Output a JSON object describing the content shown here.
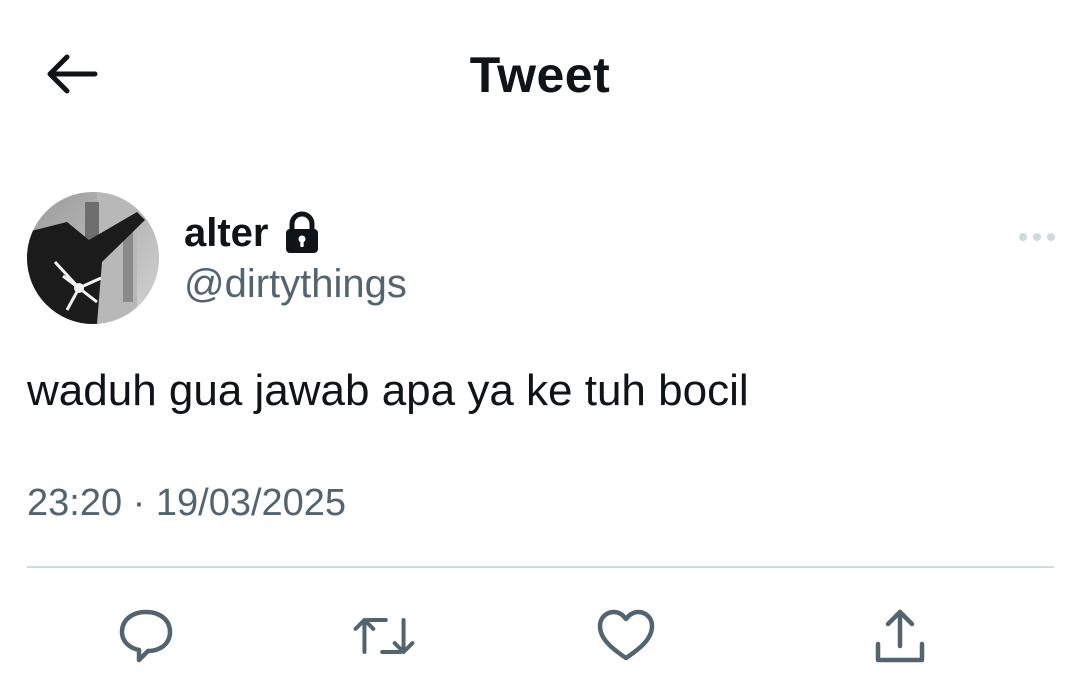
{
  "header": {
    "title": "Tweet",
    "back_icon": "arrow-left-icon"
  },
  "author": {
    "display_name": "alter",
    "handle": "@dirtythings",
    "protected_icon": "lock-icon",
    "avatar": "profile-avatar"
  },
  "tweet": {
    "text": "waduh gua jawab apa ya ke tuh bocil",
    "time": "23:20",
    "separator": "·",
    "date": "19/03/2025"
  },
  "actions": [
    {
      "name": "reply",
      "icon": "reply-bubble-icon"
    },
    {
      "name": "retweet",
      "icon": "retweet-icon"
    },
    {
      "name": "like",
      "icon": "heart-icon"
    },
    {
      "name": "share",
      "icon": "share-upload-icon"
    }
  ],
  "colors": {
    "text_primary": "#0f1419",
    "text_secondary": "#536471",
    "divider": "#cfd9de"
  }
}
